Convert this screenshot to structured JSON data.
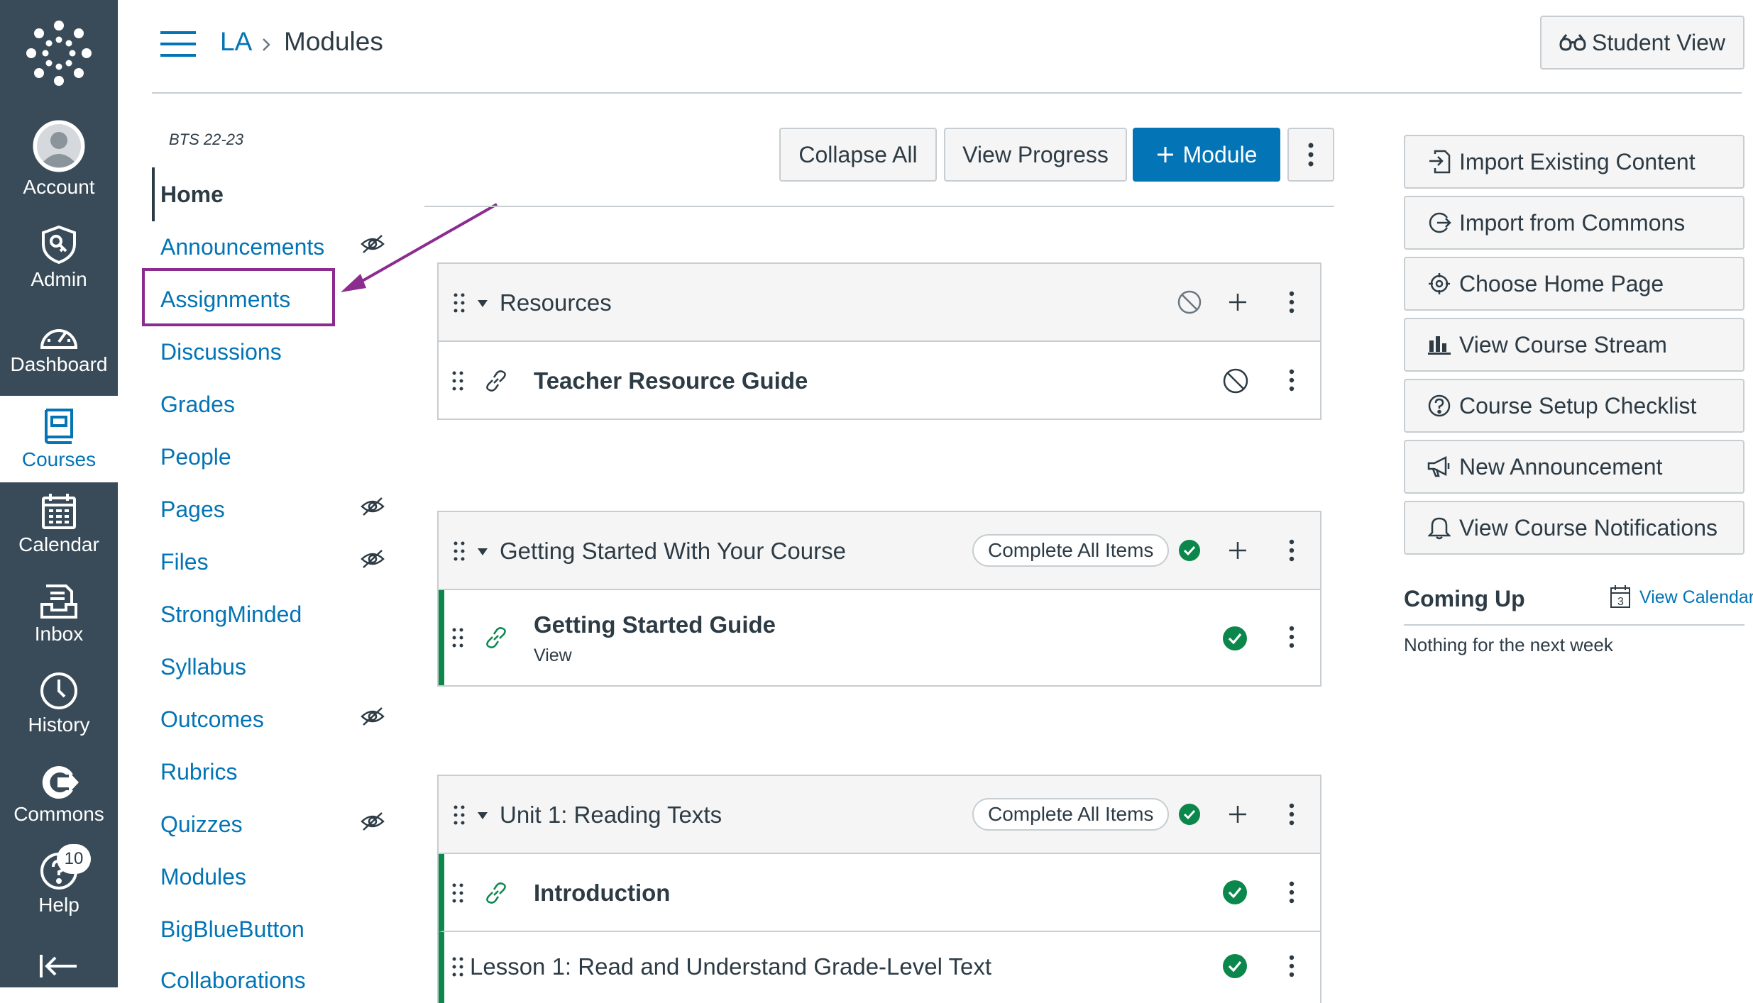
{
  "global_nav": {
    "items": [
      {
        "id": "account",
        "label": "Account"
      },
      {
        "id": "admin",
        "label": "Admin"
      },
      {
        "id": "dashboard",
        "label": "Dashboard"
      },
      {
        "id": "courses",
        "label": "Courses"
      },
      {
        "id": "calendar",
        "label": "Calendar"
      },
      {
        "id": "inbox",
        "label": "Inbox"
      },
      {
        "id": "history",
        "label": "History"
      },
      {
        "id": "commons",
        "label": "Commons"
      },
      {
        "id": "help",
        "label": "Help"
      }
    ],
    "help_badge": "10",
    "active": "Courses"
  },
  "header": {
    "breadcrumb": [
      "LA",
      "Modules"
    ],
    "student_view_label": "Student View"
  },
  "course_nav": {
    "term": "BTS 22-23",
    "items": [
      {
        "label": "Home"
      },
      {
        "label": "Announcements"
      },
      {
        "label": "Assignments"
      },
      {
        "label": "Discussions"
      },
      {
        "label": "Grades"
      },
      {
        "label": "People"
      },
      {
        "label": "Pages"
      },
      {
        "label": "Files"
      },
      {
        "label": "StrongMinded"
      },
      {
        "label": "Syllabus"
      },
      {
        "label": "Outcomes"
      },
      {
        "label": "Rubrics"
      },
      {
        "label": "Quizzes"
      },
      {
        "label": "Modules"
      },
      {
        "label": "BigBlueButton"
      },
      {
        "label": "Collaborations"
      }
    ]
  },
  "toolbar": {
    "collapse_all": "Collapse All",
    "view_progress": "View Progress",
    "add_module": "Module"
  },
  "modules": [
    {
      "title": "Resources",
      "items": [
        {
          "title": "Teacher Resource Guide"
        }
      ]
    },
    {
      "title": "Getting Started With Your Course",
      "requirement": "Complete All Items",
      "items": [
        {
          "title": "Getting Started Guide",
          "subtitle": "View"
        }
      ]
    },
    {
      "title": "Unit 1: Reading Texts",
      "requirement": "Complete All Items",
      "items": [
        {
          "title": "Introduction"
        },
        {
          "title": "Lesson 1: Read and Understand Grade-Level Text"
        }
      ]
    }
  ],
  "sidebar": {
    "buttons": [
      {
        "label": "Import Existing Content",
        "icon": "import-icon"
      },
      {
        "label": "Import from Commons",
        "icon": "commons-icon"
      },
      {
        "label": "Choose Home Page",
        "icon": "target-icon"
      },
      {
        "label": "View Course Stream",
        "icon": "bar-chart-icon"
      },
      {
        "label": "Course Setup Checklist",
        "icon": "question-icon"
      },
      {
        "label": "New Announcement",
        "icon": "megaphone-icon"
      },
      {
        "label": "View Course Notifications",
        "icon": "bell-icon"
      }
    ],
    "coming_up": {
      "title": "Coming Up",
      "view_calendar": "View Calendar",
      "calendar_day": "3",
      "empty_text": "Nothing for the next week"
    }
  },
  "colors": {
    "nav_bg": "#394b58",
    "link": "#0374b5",
    "primary": "#0374b5",
    "success": "#0b874b",
    "highlight": "#8b2c8f"
  }
}
